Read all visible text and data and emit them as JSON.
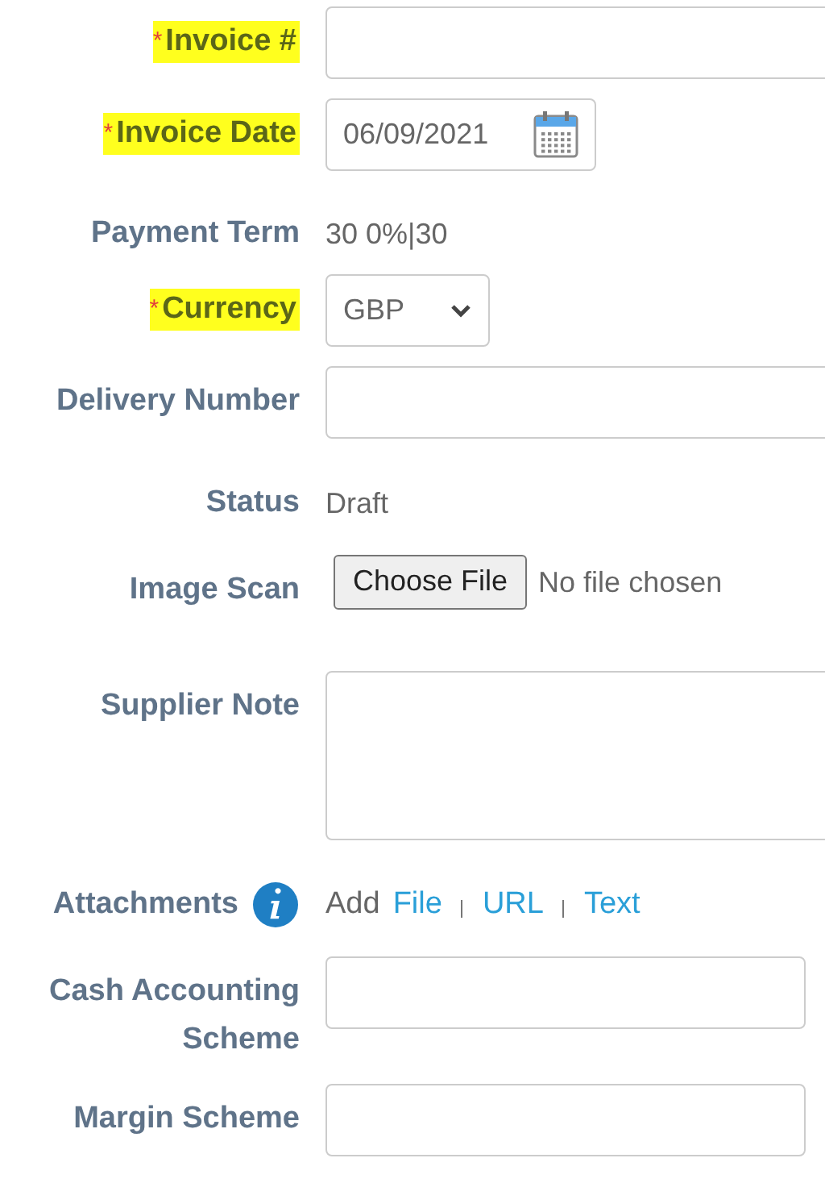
{
  "form": {
    "rows": [
      {
        "kind": "text",
        "label": "Invoice #",
        "required_mark": "*",
        "highlighted": true,
        "value": ""
      },
      {
        "kind": "date",
        "label": "Invoice Date",
        "required_mark": "*",
        "highlighted": true,
        "value": "06/09/2021"
      },
      {
        "kind": "static",
        "label": "Payment Term",
        "highlighted": false,
        "value": "30 0%|30"
      },
      {
        "kind": "select",
        "label": "Currency",
        "required_mark": "*",
        "highlighted": true,
        "value": "GBP"
      },
      {
        "kind": "text",
        "label": "Delivery Number",
        "highlighted": false,
        "value": ""
      },
      {
        "kind": "static",
        "label": "Status",
        "highlighted": false,
        "value": "Draft"
      },
      {
        "kind": "file",
        "label": "Image Scan",
        "highlighted": false,
        "button": "Choose File",
        "value": "No file chosen"
      },
      {
        "kind": "textarea",
        "label": "Supplier Note",
        "highlighted": false,
        "value": ""
      },
      {
        "kind": "attachments",
        "label": "Attachments",
        "highlighted": false,
        "prefix": "Add",
        "links": [
          "File",
          "URL",
          "Text"
        ]
      },
      {
        "kind": "short-text",
        "label": "Cash Accounting Scheme",
        "highlighted": false,
        "value": ""
      },
      {
        "kind": "short-text",
        "label": "Margin Scheme",
        "highlighted": false,
        "value": ""
      }
    ]
  }
}
